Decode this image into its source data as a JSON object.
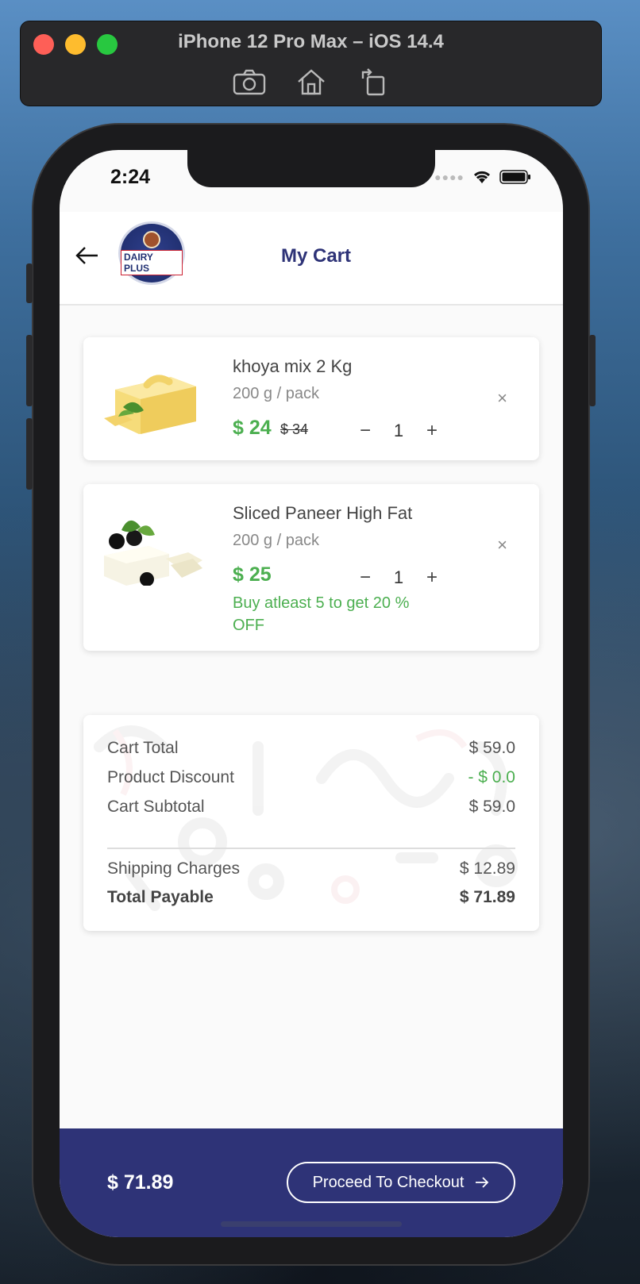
{
  "simulator": {
    "title": "iPhone 12 Pro Max – iOS 14.4",
    "tools": [
      "camera-icon",
      "home-icon",
      "rotate-icon"
    ]
  },
  "status": {
    "time": "2:24"
  },
  "appbar": {
    "title": "My Cart",
    "logo_text": "DAIRY PLUS"
  },
  "cart": {
    "items": [
      {
        "name": "khoya mix 2 Kg",
        "unit": "200 g / pack",
        "price": "$ 24",
        "old_price": "$ 34",
        "qty": "1",
        "offer": ""
      },
      {
        "name": "Sliced Paneer High Fat",
        "unit": "200 g / pack",
        "price": "$ 25",
        "old_price": "",
        "qty": "1",
        "offer": "Buy atleast 5 to get  20 % OFF"
      }
    ],
    "minus": "−",
    "plus": "+",
    "remove": "×"
  },
  "summary": {
    "cart_total_label": "Cart Total",
    "cart_total": "$ 59.0",
    "discount_label": "Product Discount",
    "discount": "- $ 0.0",
    "subtotal_label": "Cart Subtotal",
    "subtotal": "$ 59.0",
    "shipping_label": "Shipping Charges",
    "shipping": "$ 12.89",
    "payable_label": "Total Payable",
    "payable": "$ 71.89"
  },
  "footer": {
    "total": "$ 71.89",
    "checkout_label": "Proceed To Checkout"
  },
  "colors": {
    "primary": "#2e3377",
    "price_green": "#4caf50"
  }
}
